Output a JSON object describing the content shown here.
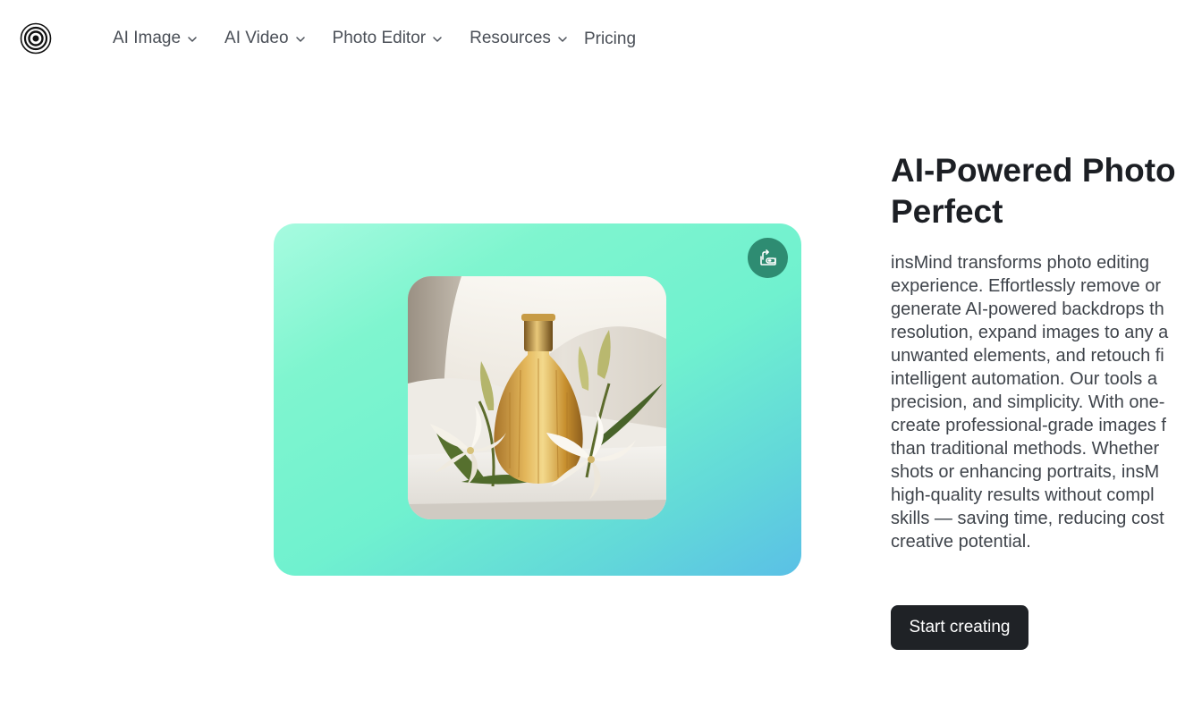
{
  "header": {
    "logo_icon": "concentric-circles-logo",
    "nav": [
      {
        "label": "AI Image",
        "has_dropdown": true
      },
      {
        "label": "AI Video",
        "has_dropdown": true
      },
      {
        "label": "Photo Editor",
        "has_dropdown": true
      },
      {
        "label": "Resources",
        "has_dropdown": true
      },
      {
        "label": "Pricing",
        "has_dropdown": false
      }
    ]
  },
  "hero": {
    "card_gradient": [
      "#a7fbe0",
      "#70f1cf",
      "#5ac0e6"
    ],
    "swap_button_icon": "eraser-swap-icon",
    "swap_button_color": "#2e8c72",
    "image_subject": "perfume-bottle-with-lilies"
  },
  "content": {
    "headline_line1": "AI-Powered Photo",
    "headline_line2": "Perfect",
    "description_lines": [
      "insMind transforms photo editing",
      "experience. Effortlessly remove or",
      "generate AI-powered backdrops th",
      "resolution, expand images to any a",
      "unwanted elements, and retouch fi",
      "intelligent automation. Our tools a",
      "precision, and simplicity. With one-",
      "create professional-grade images f",
      "than traditional methods. Whether",
      "shots or enhancing portraits, insM",
      "high-quality results without compl",
      "skills — saving time, reducing cost",
      "creative potential."
    ],
    "cta_label": "Start creating",
    "cta_color": "#1f2226"
  }
}
